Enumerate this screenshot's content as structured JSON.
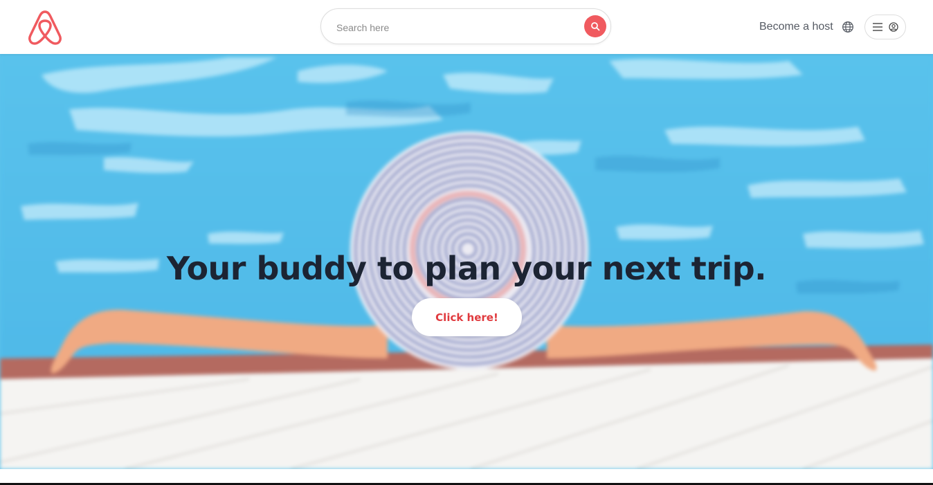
{
  "header": {
    "logo_name": "airbnb-logo",
    "search": {
      "placeholder": "Search here",
      "value": ""
    },
    "become_host_label": "Become a host",
    "icons": {
      "search": "search-icon",
      "globe": "globe-icon",
      "menu": "hamburger-icon",
      "user": "user-circle-icon"
    }
  },
  "hero": {
    "title": "Your buddy to plan your next trip.",
    "cta_label": "Click here!"
  },
  "colors": {
    "brand": "#f05a5f",
    "cta_text": "#e03a3e",
    "title": "#1c2433",
    "pool": "#5cc3ec"
  }
}
